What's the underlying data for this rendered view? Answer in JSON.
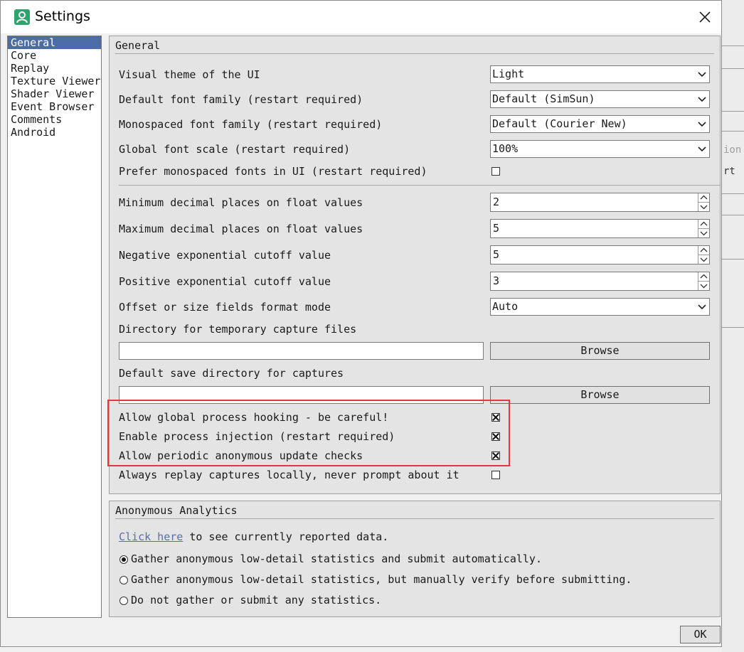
{
  "window": {
    "title": "Settings",
    "icon": "settings-app-icon"
  },
  "categories": [
    {
      "label": "General",
      "selected": true
    },
    {
      "label": "Core",
      "selected": false
    },
    {
      "label": "Replay",
      "selected": false
    },
    {
      "label": "Texture Viewer",
      "selected": false
    },
    {
      "label": "Shader Viewer",
      "selected": false
    },
    {
      "label": "Event Browser",
      "selected": false
    },
    {
      "label": "Comments",
      "selected": false
    },
    {
      "label": "Android",
      "selected": false
    }
  ],
  "general": {
    "title": "General",
    "theme": {
      "label": "Visual theme of the UI",
      "value": "Light"
    },
    "font_family": {
      "label": "Default font family (restart required)",
      "value": "Default (SimSun)"
    },
    "mono_font": {
      "label": "Monospaced font family (restart required)",
      "value": "Default (Courier New)"
    },
    "font_scale": {
      "label": "Global font scale (restart required)",
      "value": "100%"
    },
    "prefer_mono": {
      "label": "Prefer monospaced fonts in UI (restart required)",
      "checked": false
    },
    "min_decimal": {
      "label": "Minimum decimal places on float values",
      "value": "2"
    },
    "max_decimal": {
      "label": "Maximum decimal places on float values",
      "value": "5"
    },
    "neg_exp": {
      "label": "Negative exponential cutoff value",
      "value": "5"
    },
    "pos_exp": {
      "label": "Positive exponential cutoff value",
      "value": "3"
    },
    "offset_mode": {
      "label": "Offset or size fields format mode",
      "value": "Auto"
    },
    "temp_dir": {
      "label": "Directory for temporary capture files",
      "value": "",
      "browse": "Browse"
    },
    "save_dir": {
      "label": "Default save directory for captures",
      "value": "",
      "browse": "Browse"
    },
    "global_hook": {
      "label": "Allow global process hooking - be careful!",
      "checked": true
    },
    "process_injection": {
      "label": "Enable process injection (restart required)",
      "checked": true
    },
    "update_checks": {
      "label": "Allow periodic anonymous update checks",
      "checked": true
    },
    "replay_local": {
      "label": "Always replay captures locally, never prompt about it",
      "checked": false
    }
  },
  "analytics": {
    "title": "Anonymous Analytics",
    "link_text": "Click here",
    "link_suffix": "to see currently reported data.",
    "options": [
      {
        "label": "Gather anonymous low-detail statistics and submit automatically.",
        "selected": true
      },
      {
        "label": "Gather anonymous low-detail statistics, but manually verify before submitting.",
        "selected": false
      },
      {
        "label": "Do not gather or submit any statistics.",
        "selected": false
      }
    ]
  },
  "footer": {
    "ok_label": "OK"
  },
  "background": {
    "fragments": [
      "ion",
      "rt"
    ]
  },
  "colors": {
    "selection": "#4b6ca6",
    "highlight_box": "#e03a3a",
    "link": "#5a6fa6",
    "app_icon": "#2ea36c"
  }
}
